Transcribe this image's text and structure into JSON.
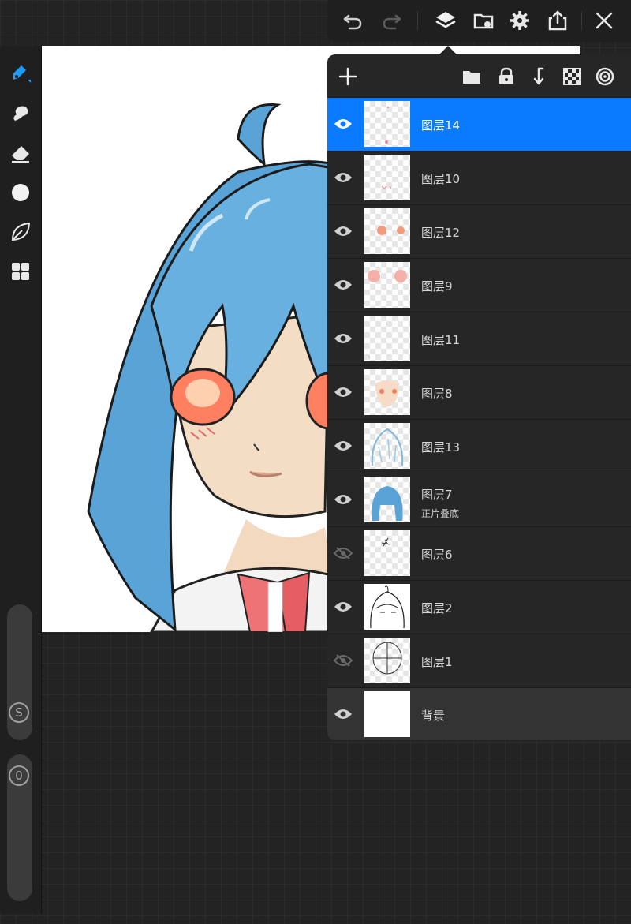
{
  "toolbar": {
    "tools": [
      {
        "name": "brush-tool",
        "icon": "brush-icon"
      },
      {
        "name": "smudge-tool",
        "icon": "smudge-icon"
      },
      {
        "name": "eraser-tool",
        "icon": "eraser-icon"
      },
      {
        "name": "color-tool",
        "icon": "color-dot-icon"
      },
      {
        "name": "selection-tool",
        "icon": "leaf-icon"
      },
      {
        "name": "gallery-tool",
        "icon": "grid-icon"
      }
    ],
    "size_slider_label": "S",
    "opacity_slider_label": "0",
    "accent": "#1a9cff"
  },
  "topbar": {
    "buttons": [
      "undo-icon",
      "redo-icon",
      "layers-icon",
      "import-icon",
      "settings-icon",
      "share-icon",
      "close-icon"
    ]
  },
  "layers_panel": {
    "header_buttons": [
      "add-icon",
      "folder-icon",
      "lock-icon",
      "merge-down-icon",
      "transparency-icon",
      "target-icon"
    ],
    "layers": [
      {
        "name": "图层14",
        "visible": true,
        "selected": true
      },
      {
        "name": "图层10",
        "visible": true
      },
      {
        "name": "图层12",
        "visible": true
      },
      {
        "name": "图层9",
        "visible": true
      },
      {
        "name": "图层11",
        "visible": true
      },
      {
        "name": "图层8",
        "visible": true
      },
      {
        "name": "图层13",
        "visible": true
      },
      {
        "name": "图层7",
        "mode": "正片叠底",
        "visible": true
      },
      {
        "name": "图层6",
        "visible": false
      },
      {
        "name": "图层2",
        "visible": true
      },
      {
        "name": "图层1",
        "visible": false
      },
      {
        "name": "背景",
        "visible": true,
        "background": true
      }
    ],
    "selected_color": "#0a7aff"
  }
}
